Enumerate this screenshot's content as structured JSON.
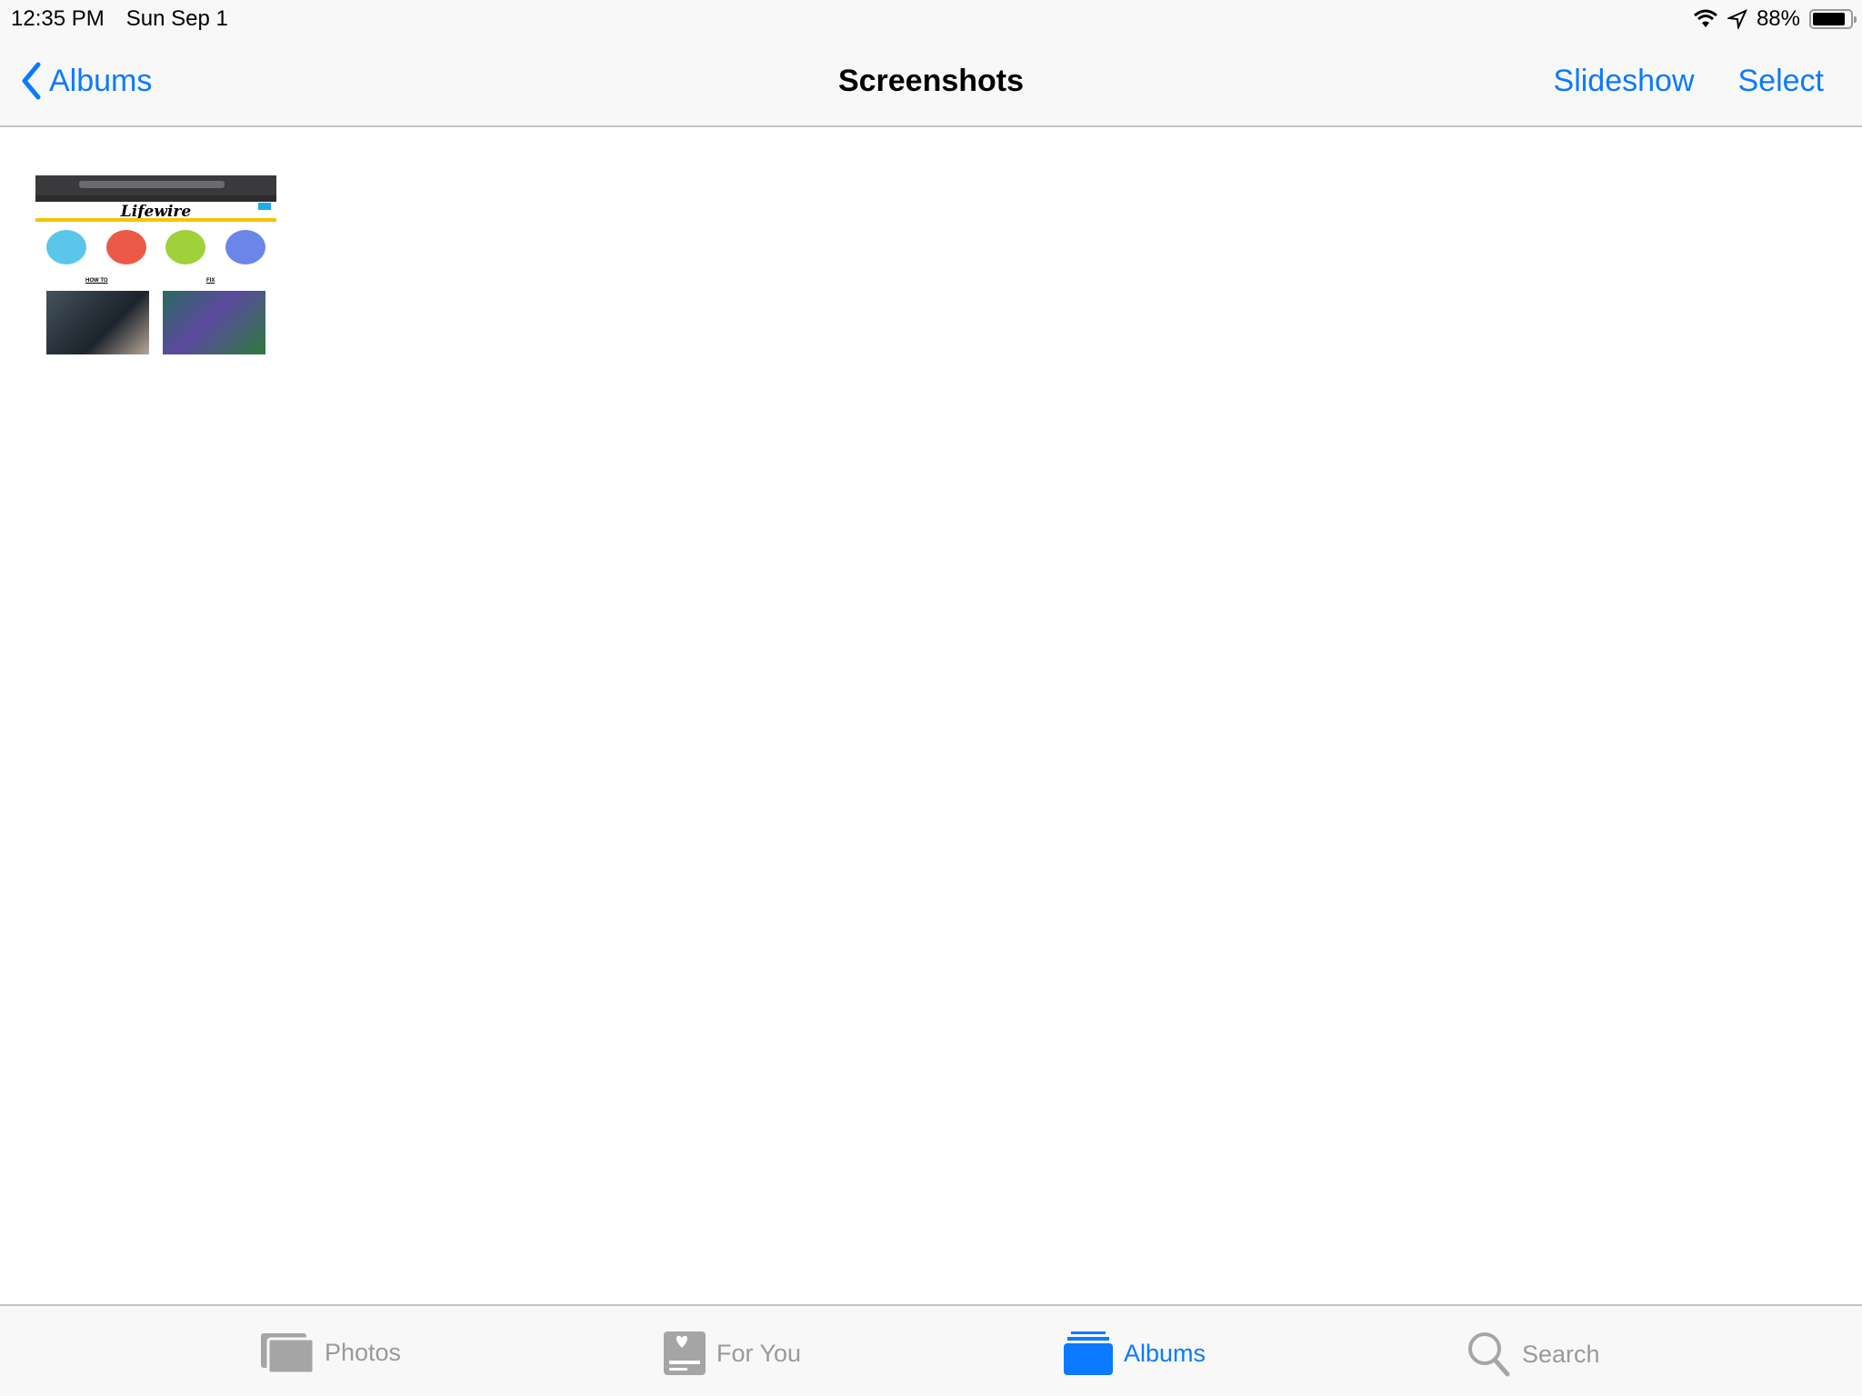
{
  "status_bar": {
    "time": "12:35 PM",
    "date": "Sun Sep 1",
    "battery_text": "88%",
    "battery_level": 0.88,
    "icons": [
      "wifi-icon",
      "location-icon",
      "battery-icon"
    ]
  },
  "nav": {
    "back_label": "Albums",
    "title": "Screenshots",
    "slideshow_label": "Slideshow",
    "select_label": "Select"
  },
  "photos": [
    {
      "logo_text": "Lifewire",
      "labels": [
        "HOW TO",
        "FIX"
      ]
    }
  ],
  "tabs": [
    {
      "label": "Photos",
      "icon": "photos-icon",
      "active": false
    },
    {
      "label": "For You",
      "icon": "for-you-icon",
      "active": false
    },
    {
      "label": "Albums",
      "icon": "albums-icon",
      "active": true
    },
    {
      "label": "Search",
      "icon": "search-icon",
      "active": false
    }
  ],
  "colors": {
    "accent": "#0a7aff",
    "inactive": "#9a9a9a",
    "bar_bg": "#f8f8f8"
  }
}
